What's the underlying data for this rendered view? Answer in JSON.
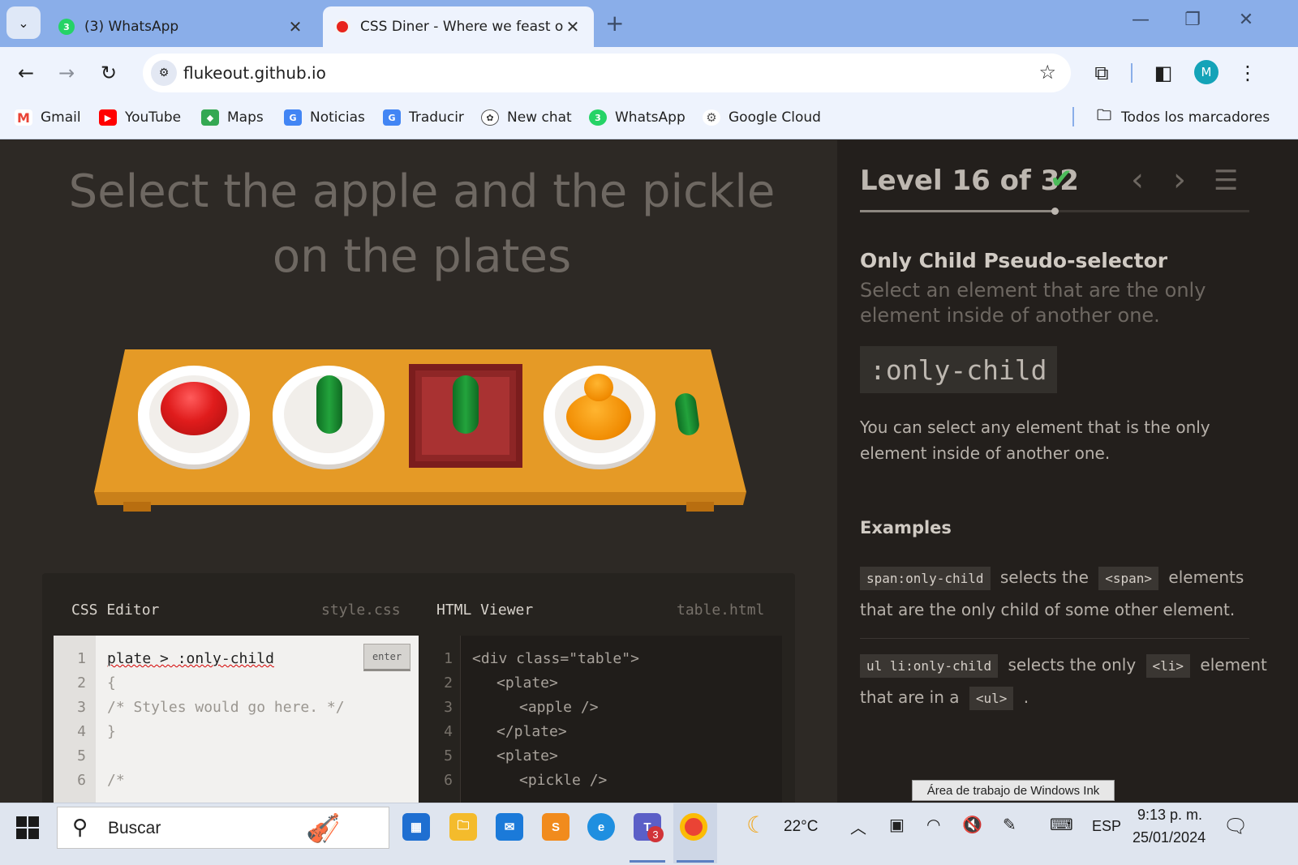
{
  "browser": {
    "tabs": [
      {
        "title": "(3) WhatsApp",
        "badge": "3",
        "active": false
      },
      {
        "title": "CSS Diner - Where we feast on CSS",
        "active": true
      }
    ],
    "url": "flukeout.github.io",
    "profile_initial": "M",
    "bookmarks": [
      "Gmail",
      "YouTube",
      "Maps",
      "Noticias",
      "Traducir",
      "New chat",
      "WhatsApp",
      "Google Cloud"
    ],
    "all_bookmarks": "Todos los marcadores"
  },
  "game": {
    "order_line1": "Select the apple and the pickle",
    "order_line2": "on the plates"
  },
  "editor": {
    "css_title": "CSS Editor",
    "css_file": "style.css",
    "html_title": "HTML Viewer",
    "html_file": "table.html",
    "enter_label": "enter",
    "css_lines": [
      "plate > :only-child",
      "{",
      "/* Styles would go here. */",
      "}",
      "",
      "/*"
    ],
    "css_line_numbers": [
      "1",
      "2",
      "3",
      "4",
      "5",
      "6"
    ],
    "html_lines": [
      "<div class=\"table\">",
      "<plate>",
      "<apple />",
      "</plate>",
      "<plate>",
      "<pickle />"
    ],
    "html_line_numbers": [
      "1",
      "2",
      "3",
      "4",
      "5",
      "6"
    ]
  },
  "sidebar": {
    "level_text": "Level 16 of 32",
    "level_current": 16,
    "level_total": 32,
    "selector_name": "Only Child Pseudo-selector",
    "selector_title": "Select an element that are the only element inside of another one.",
    "syntax": ":only-child",
    "hint": "You can select any element that is the only element inside of another one.",
    "examples_title": "Examples",
    "example1": {
      "code": "span:only-child",
      "t1": "selects the",
      "tag": "<span>",
      "t2": "elements that are the only child of some other element."
    },
    "example2": {
      "code": "ul li:only-child",
      "t1": "selects the only",
      "tag": "<li>",
      "t2": "element that are in a",
      "tag2": "<ul>",
      "t3": "."
    }
  },
  "tooltip": "Área de trabajo de Windows Ink",
  "taskbar": {
    "search_placeholder": "Buscar",
    "weather": "22°C",
    "language": "ESP",
    "time": "9:13 p. m.",
    "date": "25/01/2024",
    "teams_badge": "3"
  },
  "colors": {
    "accent_check": "#4cbb5a",
    "table": "#e59a26",
    "apple": "#e01c1c",
    "pickle": "#23a33c",
    "orange": "#f08a00"
  }
}
